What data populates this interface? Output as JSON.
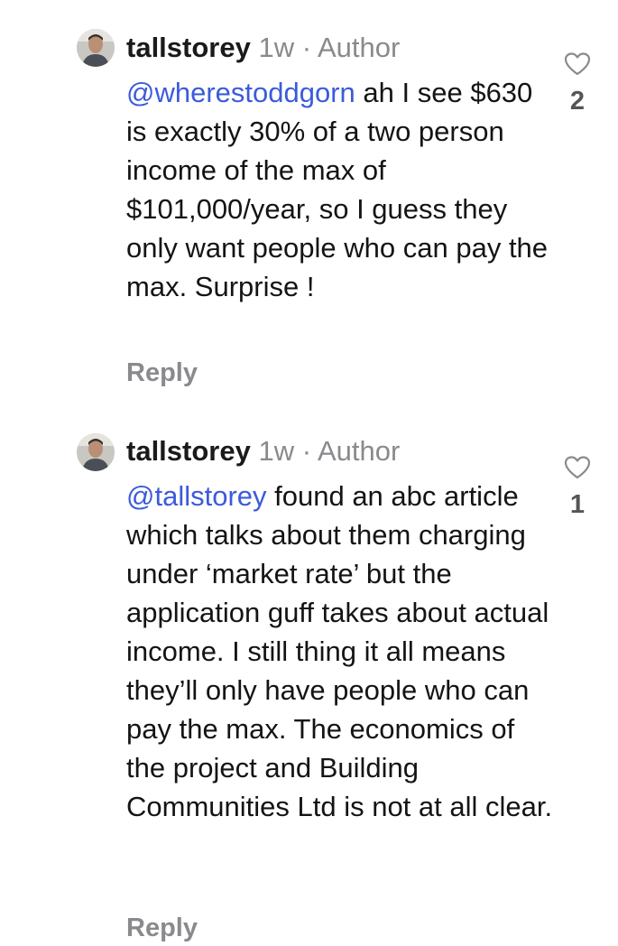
{
  "comments": [
    {
      "username": "tallstorey",
      "time": "1w",
      "separator": "·",
      "role": "Author",
      "mention": "@wherestoddgorn",
      "text": " ah I see $630 is exactly 30% of a two person income of the max of $101,000/year, so I guess they only want people who can pay the max. Surprise !",
      "reply_label": "Reply",
      "like_icon": "heart-outline-icon",
      "likes": "2"
    },
    {
      "username": "tallstorey",
      "time": "1w",
      "separator": "·",
      "role": "Author",
      "mention": "@tallstorey",
      "text": " found an abc article which talks about them charging under ‘market rate’ but the application guff takes about actual income. I still thing it all means they’ll only have people who can pay the max. The economics of the project and Building Communities Ltd is not at all clear.",
      "reply_label": "Reply",
      "like_icon": "heart-outline-icon",
      "likes": "1"
    }
  ],
  "colors": {
    "mention": "#3b5bdb",
    "secondary": "#8a8a8e",
    "text": "#141414"
  }
}
